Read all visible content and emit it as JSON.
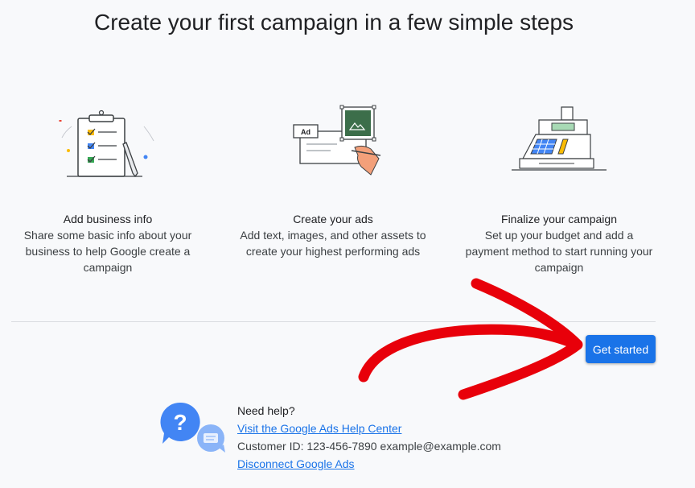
{
  "page": {
    "title": "Create your first campaign in a few simple steps"
  },
  "steps": [
    {
      "title": "Add business info",
      "description": "Share some basic info about your business to help Google create a campaign",
      "icon": "clipboard-checklist-icon"
    },
    {
      "title": "Create your ads",
      "description": "Add text, images, and other assets to create your highest performing ads",
      "icon": "ad-creative-icon",
      "ad_label": "Ad"
    },
    {
      "title": "Finalize your campaign",
      "description": "Set up your budget and add a payment method to start running your campaign",
      "icon": "cash-register-icon"
    }
  ],
  "actions": {
    "get_started_label": "Get started"
  },
  "help": {
    "heading": "Need help?",
    "help_center_link": "Visit the Google Ads Help Center",
    "customer_id_label": "Customer ID: 123-456-7890",
    "email": "example@example.com",
    "disconnect_link": "Disconnect Google Ads"
  },
  "colors": {
    "primary": "#1a73e8",
    "annotation_arrow": "#e8000a",
    "background": "#f8f9fb"
  }
}
